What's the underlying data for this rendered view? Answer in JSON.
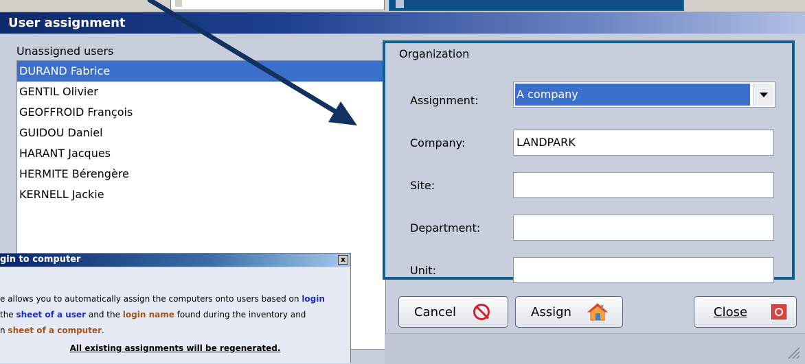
{
  "dialog": {
    "title": "User assignment"
  },
  "unassigned": {
    "label": "Unassigned users",
    "users": [
      "DURAND Fabrice",
      "GENTIL Olivier",
      "GEOFFROID François",
      "GUIDOU Daniel",
      "HARANT Jacques",
      "HERMITE Bérengère",
      "KERNELL Jackie"
    ],
    "selected_index": 0
  },
  "organization": {
    "title": "Organization",
    "assignment_label": "Assignment:",
    "assignment_value": "A company",
    "company_label": "Company:",
    "company_value": "LANDPARK",
    "site_label": "Site:",
    "site_value": "",
    "department_label": "Department:",
    "department_value": "",
    "unit_label": "Unit:",
    "unit_value": ""
  },
  "buttons": {
    "cancel": "Cancel",
    "assign": "Assign",
    "close": "Close"
  },
  "login_dialog": {
    "title": "gin to computer",
    "close_glyph": "x",
    "line1_prefix": "e allows you to automatically assign the computers onto users based on ",
    "line1_hl": "login",
    "line2_prefix": "the ",
    "line2_hl1": "sheet of a user",
    "line2_mid": " and the ",
    "line2_hl2": "login name",
    "line2_suffix": " found during the inventory and",
    "line3_prefix": "n ",
    "line3_hl": "sheet of a computer",
    "line3_suffix": ".",
    "warning": "All existing assignments will be regenerated."
  },
  "colors": {
    "selection": "#3a6fcb",
    "org_border": "#0d5f92",
    "title_bar": "#0f2a6b",
    "arrow": "#13315f",
    "highlight_blue": "#1a2ec6",
    "highlight_brown": "#a0541e"
  }
}
